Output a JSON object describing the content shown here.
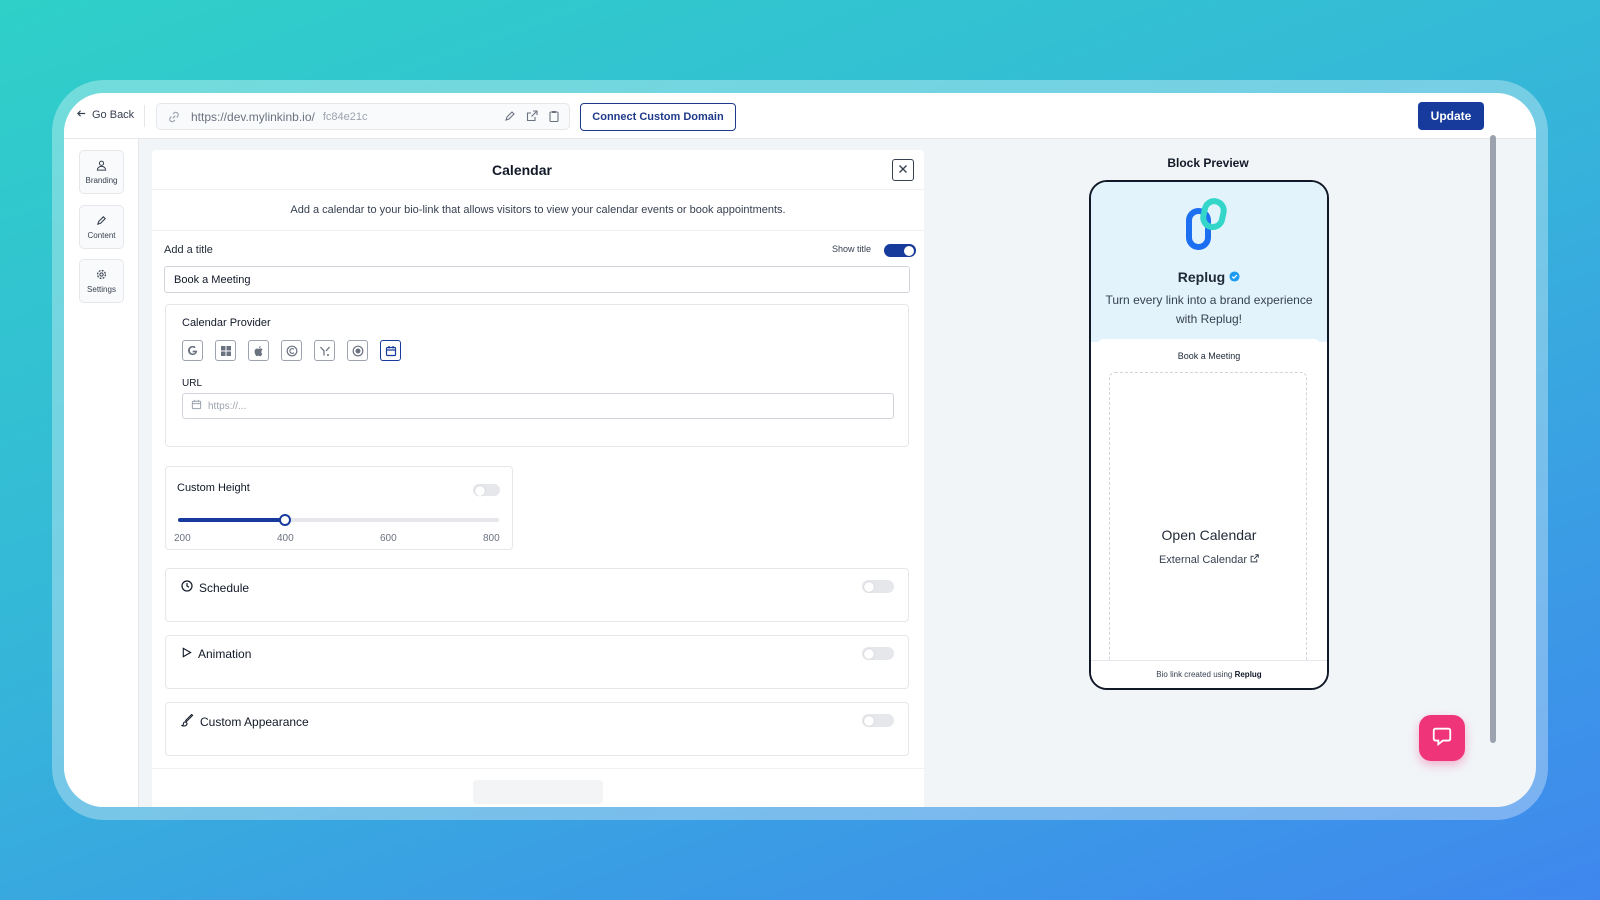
{
  "topbar": {
    "go_back": "Go Back",
    "url_base": "https://dev.mylinkinb.io/",
    "url_slug": "fc84e21c",
    "connect_domain": "Connect Custom Domain",
    "update": "Update"
  },
  "nav": {
    "items": [
      {
        "label": "Branding",
        "icon": "user-icon"
      },
      {
        "label": "Content",
        "icon": "pencil-icon"
      },
      {
        "label": "Settings",
        "icon": "gear-icon"
      }
    ]
  },
  "editor": {
    "title": "Calendar",
    "description": "Add a calendar to your bio-link that allows visitors to view your calendar events or book appointments.",
    "add_title_label": "Add a title",
    "show_title_label": "Show title",
    "show_title_on": true,
    "title_value": "Book a Meeting",
    "provider_label": "Calendar Provider",
    "providers": [
      "google-calendar-icon",
      "microsoft-calendar-icon",
      "apple-calendar-icon",
      "calendly-icon",
      "cal-com-icon",
      "tidycal-icon",
      "custom-calendar-icon"
    ],
    "selected_provider": 6,
    "url_label": "URL",
    "url_placeholder": "https://...",
    "custom_height_label": "Custom Height",
    "custom_height_on": false,
    "height_value": 400,
    "height_min": 200,
    "height_max": 800,
    "height_ticks": [
      "200",
      "400",
      "600",
      "800"
    ],
    "sections": [
      {
        "label": "Schedule",
        "icon": "clock-icon",
        "on": false
      },
      {
        "label": "Animation",
        "icon": "play-icon",
        "on": false
      },
      {
        "label": "Custom Appearance",
        "icon": "brush-icon",
        "on": false
      }
    ]
  },
  "preview": {
    "title": "Block Preview",
    "brand_name": "Replug",
    "brand_desc": "Turn every link into a brand experience with Replug!",
    "card_title": "Book a Meeting",
    "open_calendar": "Open Calendar",
    "external_calendar": "External Calendar",
    "footer_text": "Bio link created using",
    "footer_brand": "Replug"
  },
  "colors": {
    "accent": "#173b9c",
    "chat": "#f0347a",
    "preview_bg": "#e2f3fb"
  }
}
